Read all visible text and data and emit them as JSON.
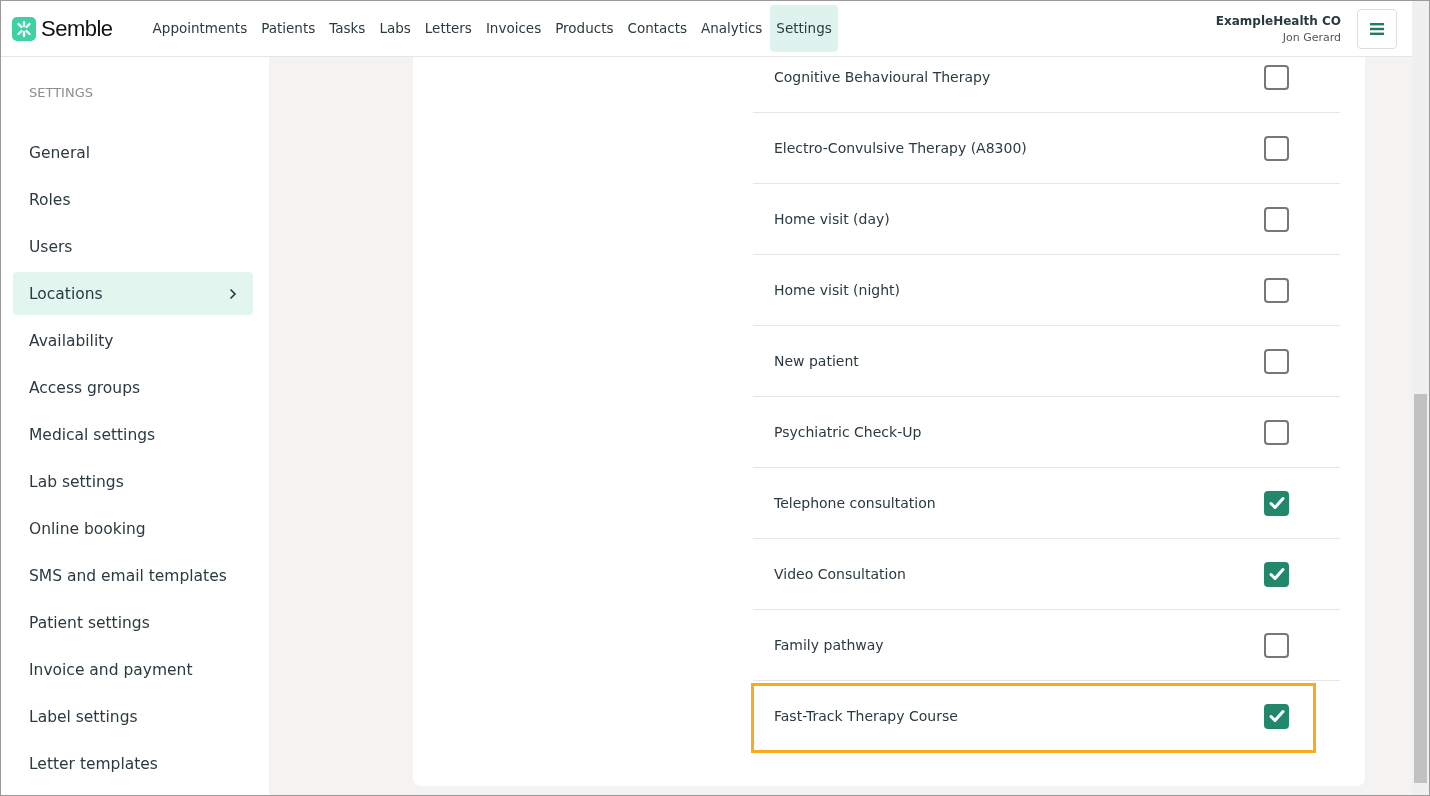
{
  "brand": {
    "name": "Semble"
  },
  "nav": [
    {
      "label": "Appointments",
      "selected": false
    },
    {
      "label": "Patients",
      "selected": false
    },
    {
      "label": "Tasks",
      "selected": false
    },
    {
      "label": "Labs",
      "selected": false
    },
    {
      "label": "Letters",
      "selected": false
    },
    {
      "label": "Invoices",
      "selected": false
    },
    {
      "label": "Products",
      "selected": false
    },
    {
      "label": "Contacts",
      "selected": false
    },
    {
      "label": "Analytics",
      "selected": false
    },
    {
      "label": "Settings",
      "selected": true
    }
  ],
  "account": {
    "organisation": "ExampleHealth CO",
    "user": "Jon Gerard"
  },
  "sidebar": {
    "heading": "SETTINGS",
    "items": [
      {
        "label": "General",
        "selected": false
      },
      {
        "label": "Roles",
        "selected": false
      },
      {
        "label": "Users",
        "selected": false
      },
      {
        "label": "Locations",
        "selected": true
      },
      {
        "label": "Availability",
        "selected": false
      },
      {
        "label": "Access groups",
        "selected": false
      },
      {
        "label": "Medical settings",
        "selected": false
      },
      {
        "label": "Lab settings",
        "selected": false
      },
      {
        "label": "Online booking",
        "selected": false
      },
      {
        "label": "SMS and email templates",
        "selected": false
      },
      {
        "label": "Patient settings",
        "selected": false
      },
      {
        "label": "Invoice and payment",
        "selected": false
      },
      {
        "label": "Label settings",
        "selected": false
      },
      {
        "label": "Letter templates",
        "selected": false
      }
    ]
  },
  "appointment_types": [
    {
      "label": "Cognitive Behavioural Therapy",
      "checked": false,
      "highlighted": false
    },
    {
      "label": "Electro-Convulsive Therapy (A8300)",
      "checked": false,
      "highlighted": false
    },
    {
      "label": "Home visit (day)",
      "checked": false,
      "highlighted": false
    },
    {
      "label": "Home visit (night)",
      "checked": false,
      "highlighted": false
    },
    {
      "label": "New patient",
      "checked": false,
      "highlighted": false
    },
    {
      "label": "Psychiatric Check-Up",
      "checked": false,
      "highlighted": false
    },
    {
      "label": "Telephone consultation",
      "checked": true,
      "highlighted": false
    },
    {
      "label": "Video Consultation",
      "checked": true,
      "highlighted": false
    },
    {
      "label": "Family pathway",
      "checked": false,
      "highlighted": false
    },
    {
      "label": "Fast-Track Therapy Course",
      "checked": true,
      "highlighted": true
    }
  ]
}
